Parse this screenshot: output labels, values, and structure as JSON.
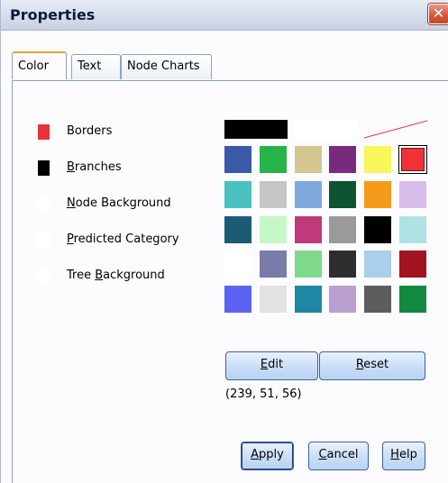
{
  "window": {
    "title": "Properties",
    "close_glyph": "✕"
  },
  "tabs": [
    {
      "label": "Color",
      "active": true
    },
    {
      "label": "Text",
      "active": false
    },
    {
      "label": "Node Charts",
      "active": false
    }
  ],
  "elements": [
    {
      "label": "Borders",
      "color": "#e8333c"
    },
    {
      "label": "Branches",
      "color": "#000000"
    },
    {
      "label": "Node Background",
      "color": "#ffffff"
    },
    {
      "label": "Predicted Category",
      "color": "#ffffff"
    },
    {
      "label": "Tree Background",
      "color": "#ffffff"
    }
  ],
  "palette": {
    "presets": [
      {
        "name": "black",
        "color": "#000000"
      },
      {
        "name": "white",
        "color": "#ffffff"
      },
      {
        "name": "none",
        "color": "transparent"
      }
    ],
    "rows": [
      [
        "#3b5aa5",
        "#27b24a",
        "#d1c78f",
        "#7a2a7d",
        "#f8f65a",
        "#ef3238"
      ],
      [
        "#4bc2c1",
        "#c5c5c5",
        "#7fa9dc",
        "#0d5431",
        "#f59a1a",
        "#d8bdeb"
      ],
      [
        "#1b5c74",
        "#c6f7c8",
        "#be3a7a",
        "#9a9a9a",
        "#000000",
        "#ade3e3"
      ],
      [
        "#ffffff",
        "#7a7ba8",
        "#7ed98d",
        "#2e2e2e",
        "#a9cfeb",
        "#a11420"
      ],
      [
        "#5c63f2",
        "#e2e2e2",
        "#1e88a4",
        "#b9a0d0",
        "#5d5d5d",
        "#128a42"
      ]
    ],
    "selected": "#ef3238"
  },
  "buttons": {
    "edit": "Edit",
    "reset": "Reset",
    "apply": "Apply",
    "cancel": "Cancel",
    "help": "Help"
  },
  "selected_rgb": "(239, 51, 56)"
}
